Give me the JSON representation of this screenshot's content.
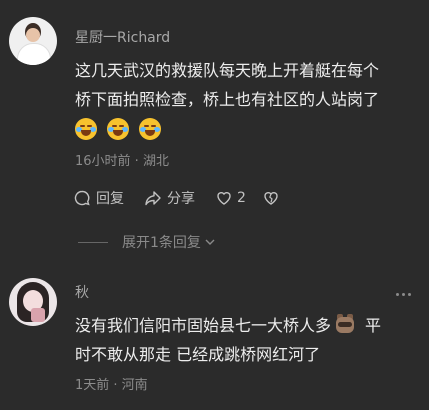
{
  "comments": [
    {
      "username": "星厨一Richard",
      "text_line1": "这几天武汉的救援队每天晚上开着艇在每个",
      "text_line2": "桥下面拍照检查，桥上也有社区的人站岗了",
      "emojis": [
        "crying-laughing-emoji",
        "crying-laughing-emoji",
        "crying-laughing-emoji"
      ],
      "meta": "16小时前 · 湖北",
      "actions": {
        "reply_label": "回复",
        "share_label": "分享",
        "like_count": "2"
      },
      "expand_label": "展开1条回复"
    },
    {
      "username": "秋",
      "text_line1_a": "没有我们信阳市固始县七一大桥人多",
      "text_line1_b": "平",
      "text_line2": "时不敢从那走 已经成跳桥网红河了",
      "meta": "1天前 · 河南"
    }
  ],
  "colors": {
    "background": "#2b2b2b",
    "text": "#ededed",
    "muted": "#8c8c8c"
  }
}
